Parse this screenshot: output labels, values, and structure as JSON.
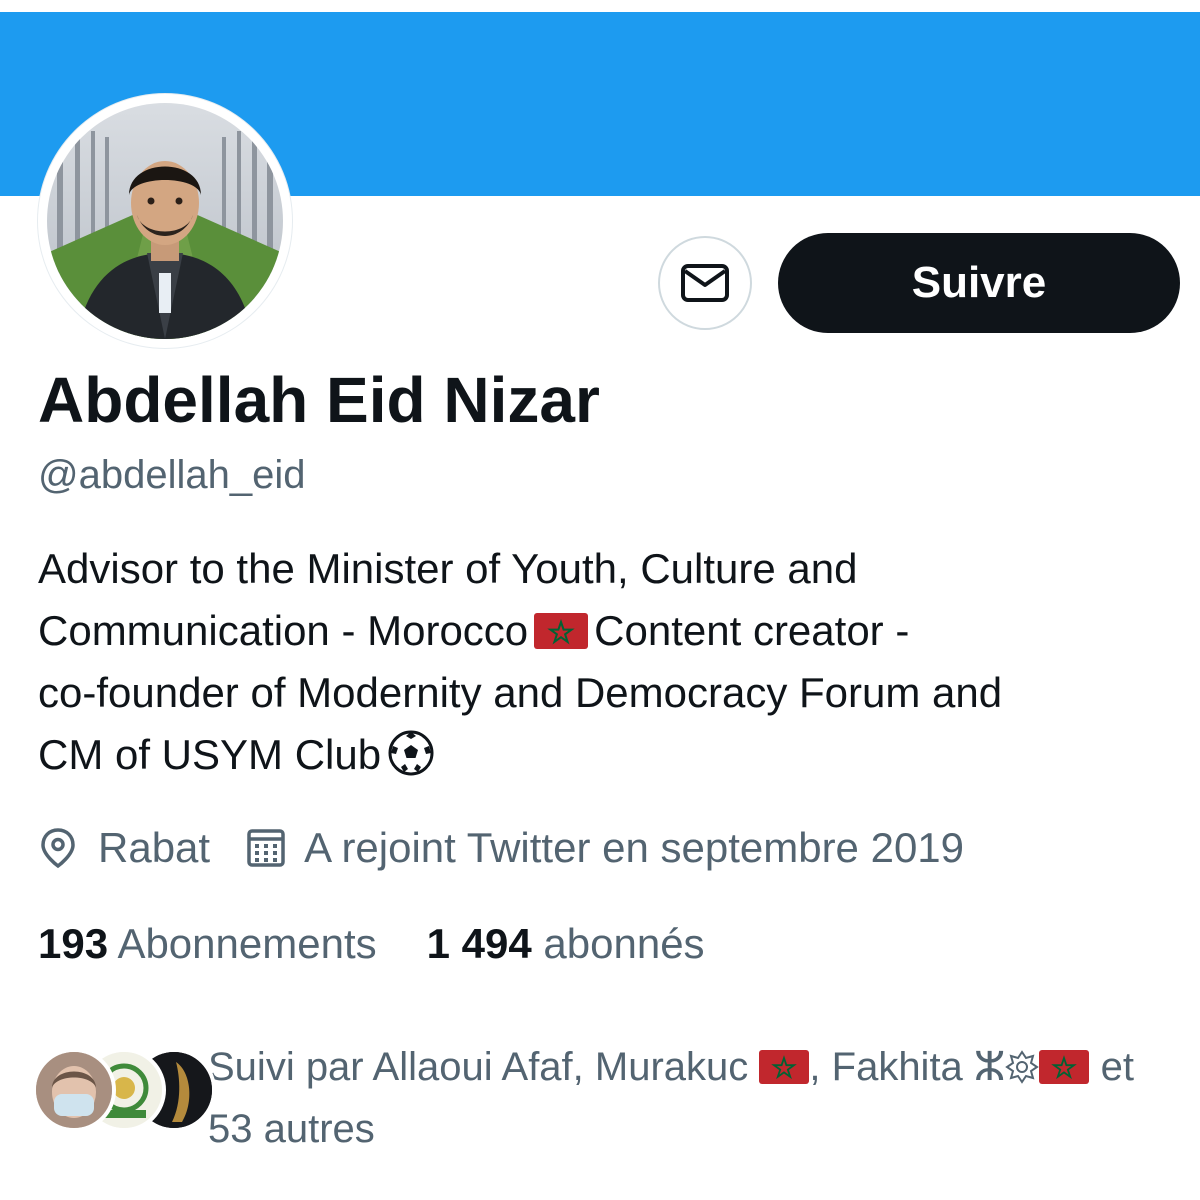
{
  "profile": {
    "display_name": "Abdellah Eid Nizar",
    "handle": "@abdellah_eid",
    "follow_label": "Suivre"
  },
  "bio": {
    "line1": "Advisor to the Minister of Youth, Culture and",
    "line2_a": "Communication - Morocco",
    "line2_b": "Content creator -",
    "line3": "co-founder of Modernity and Democracy Forum and",
    "line4": "CM of USYM Club"
  },
  "meta": {
    "location": "Rabat",
    "joined": "A rejoint Twitter en septembre 2019"
  },
  "stats": {
    "following_count": "193",
    "following_label": "Abonnements",
    "followers_count": "1 494",
    "followers_label": "abonnés"
  },
  "followed_by": {
    "prefix": "Suivi par Allaoui Afaf, Murakuc",
    "sep": ", Fakhita ⵣ",
    "suffix": "et",
    "others": "53 autres"
  },
  "colors": {
    "banner": "#1d9bf0",
    "primary_text": "#0f1419",
    "secondary_text": "#536471",
    "button_dark": "#0f1419",
    "flag_red": "#c1272d",
    "flag_green": "#006233"
  },
  "icons": {
    "message": "envelope-icon",
    "location": "location-pin-icon",
    "calendar": "calendar-icon",
    "flag": "morocco-flag-emoji",
    "ball": "soccer-ball-emoji"
  }
}
